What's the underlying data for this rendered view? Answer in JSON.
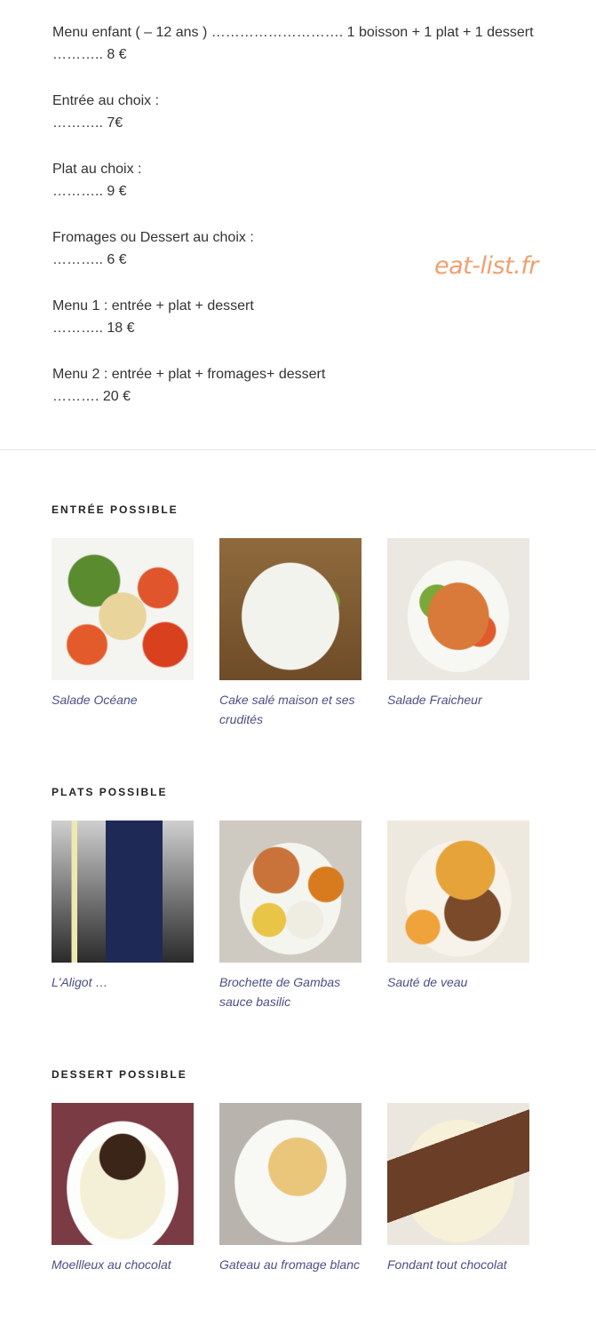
{
  "menu": [
    {
      "line1": "Menu enfant ( – 12 ans )  ……………………….  1 boisson + 1 plat + 1 dessert",
      "line2": "………..  8 €"
    },
    {
      "line1": "Entrée au choix :",
      "line2": "………..  7€"
    },
    {
      "line1": "Plat au choix       :",
      "line2": "………..  9 €"
    },
    {
      "line1": "Fromages ou Dessert au choix :",
      "line2": "………..  6 €"
    },
    {
      "line1": "Menu 1 :   entrée + plat + dessert",
      "line2": "……….. 18 €"
    },
    {
      "line1": "Menu 2 :   entrée +  plat +  fromages+ dessert",
      "line2": "………. 20 €"
    }
  ],
  "watermark": "eat-list.fr",
  "sections": [
    {
      "title": "ENTRÉE POSSIBLE",
      "items": [
        {
          "caption": "Salade Océane"
        },
        {
          "caption": "Cake salé maison et ses crudités"
        },
        {
          "caption": "Salade Fraicheur"
        }
      ]
    },
    {
      "title": "PLATS POSSIBLE",
      "items": [
        {
          "caption": "L'Aligot …"
        },
        {
          "caption": "Brochette de Gambas sauce basilic"
        },
        {
          "caption": "Sauté de veau"
        }
      ]
    },
    {
      "title": "DESSERT POSSIBLE",
      "items": [
        {
          "caption": "Moellleux au chocolat"
        },
        {
          "caption": "Gateau au fromage blanc"
        },
        {
          "caption": "Fondant tout chocolat"
        }
      ]
    }
  ]
}
